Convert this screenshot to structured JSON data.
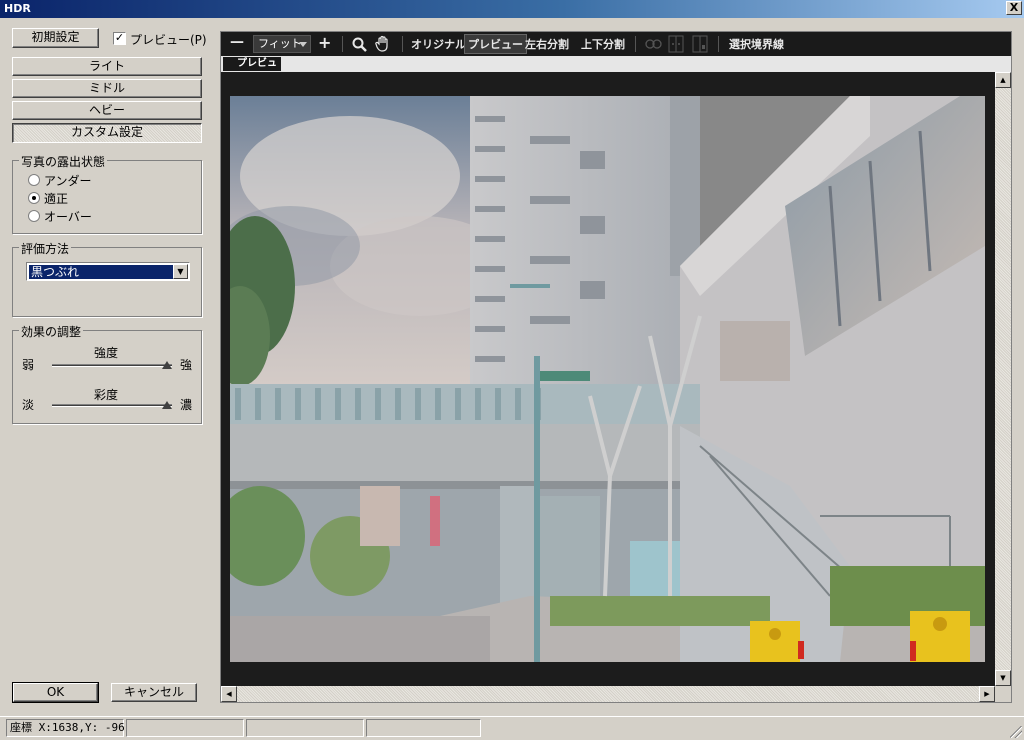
{
  "window": {
    "title": "HDR",
    "close_symbol": "X"
  },
  "left_panel": {
    "reset_button": "初期設定",
    "preview_checkbox": {
      "label": "プレビュー(P)",
      "checked": true,
      "check_mark": "✓"
    },
    "presets": [
      "ライト",
      "ミドル",
      "ヘビー",
      "カスタム設定"
    ],
    "selected_preset": "カスタム設定",
    "exposure_group": {
      "title": "写真の露出状態",
      "options": [
        "アンダー",
        "適正",
        "オーバー"
      ],
      "selected": "適正"
    },
    "evaluation_group": {
      "title": "評価方法",
      "selected_value": "黒つぶれ"
    },
    "effect_group": {
      "title": "効果の調整",
      "strength": {
        "label": "強度",
        "min_label": "弱",
        "max_label": "強",
        "level": 1.0
      },
      "saturation": {
        "label": "彩度",
        "min_label": "淡",
        "max_label": "濃",
        "level": 1.0
      }
    },
    "ok_button": "OK",
    "cancel_button": "キャンセル"
  },
  "preview_toolbar": {
    "zoom_out_symbol": "—",
    "zoom_value": "フィット",
    "zoom_in_symbol": "+",
    "search_icon": "magnifier-icon",
    "hand_icon": "hand-icon",
    "view_modes": [
      "オリジナル",
      "プレビュー",
      "左右分割",
      "上下分割"
    ],
    "active_view_mode": "プレビュー",
    "select_boundary": "選択境界線"
  },
  "preview_tab": {
    "label": "プレビュー"
  },
  "scrollbars": {
    "up": "▲",
    "down": "▼",
    "left": "◀",
    "right": "▶"
  },
  "status_bar": {
    "coordinates": "座標 X:1638,Y: -96",
    "cells": [
      "",
      "",
      ""
    ]
  },
  "colors": {
    "titlebar_start": "#0a246a",
    "titlebar_end": "#a6caf0",
    "dialog_bg": "#d4d0c8",
    "toolbar_bg": "#1a1a1a",
    "selection": "#0a246a"
  }
}
